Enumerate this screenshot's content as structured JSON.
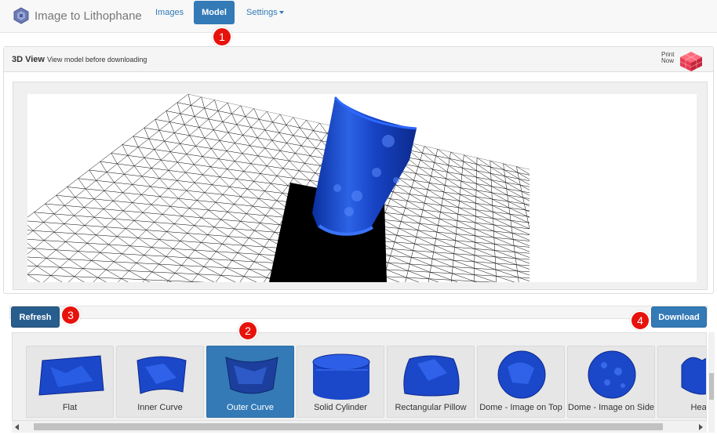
{
  "navbar": {
    "brand": "Image to Lithophane",
    "items": [
      {
        "label": "Images"
      },
      {
        "label": "Model"
      },
      {
        "label": "Settings"
      }
    ]
  },
  "panel": {
    "title": "3D View",
    "subtitle": "View model before downloading",
    "print_now": "Print\nNow"
  },
  "buttons": {
    "refresh": "Refresh",
    "download": "Download"
  },
  "shapes": [
    {
      "label": "Flat"
    },
    {
      "label": "Inner Curve"
    },
    {
      "label": "Outer Curve",
      "selected": true
    },
    {
      "label": "Solid Cylinder"
    },
    {
      "label": "Rectangular Pillow"
    },
    {
      "label": "Dome - Image on Top"
    },
    {
      "label": "Dome - Image on Side"
    },
    {
      "label": "Heart"
    }
  ],
  "badges": [
    "1",
    "2",
    "3",
    "4"
  ],
  "colors": {
    "accent": "#337ab7",
    "badge": "#e8120c",
    "model_blue": "#1f4fd1"
  }
}
